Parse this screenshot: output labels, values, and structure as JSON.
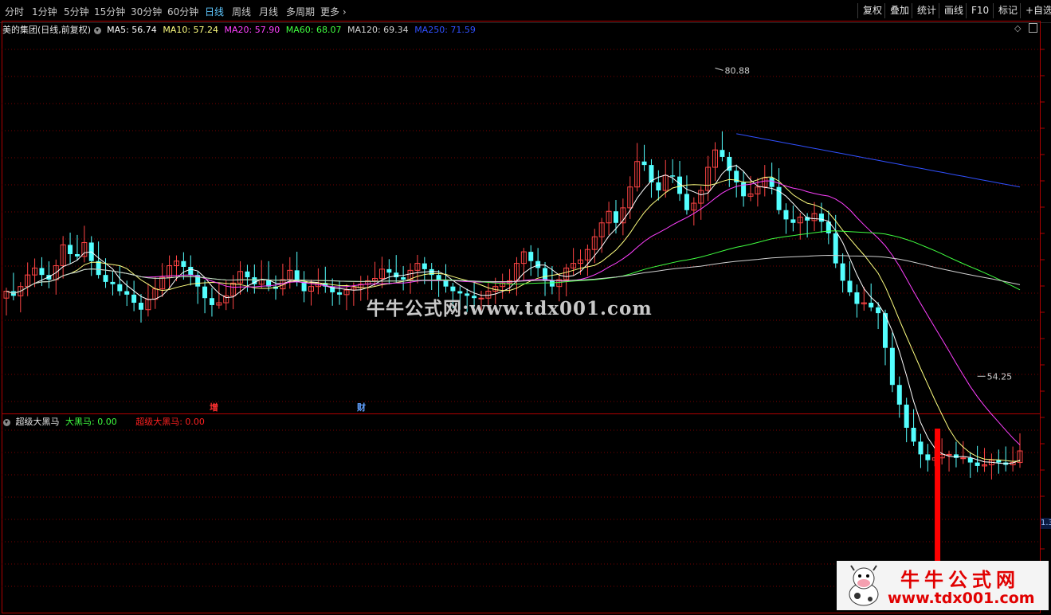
{
  "toolbar": {
    "timeframes": [
      "分时",
      "1分钟",
      "5分钟",
      "15分钟",
      "30分钟",
      "60分钟",
      "日线",
      "周线",
      "月线",
      "多周期",
      "更多"
    ],
    "active_timeframe": "日线",
    "right_buttons": [
      "复权",
      "叠加",
      "统计",
      "画线",
      "F10",
      "标记",
      "+自选"
    ]
  },
  "stock": {
    "title": "美的集团(日线,前复权)"
  },
  "ma_legend": [
    {
      "label": "MA5: 56.74",
      "color": "#ffffff"
    },
    {
      "label": "MA10: 57.24",
      "color": "#ffff80"
    },
    {
      "label": "MA20: 57.90",
      "color": "#ff40ff"
    },
    {
      "label": "MA60: 68.07",
      "color": "#40ff40"
    },
    {
      "label": "MA120: 69.34",
      "color": "#d0d0d0"
    },
    {
      "label": "MA250: 71.59",
      "color": "#3050ff"
    }
  ],
  "indicator": {
    "name": "超级大黑马",
    "series": [
      {
        "label": "大黑马: 0.00",
        "color": "#40ff40"
      },
      {
        "label": "超级大黑马: 0.00",
        "color": "#ff2020"
      }
    ],
    "right_label": "1.3"
  },
  "markers": [
    {
      "text": "增",
      "color": "#ff3030"
    },
    {
      "text": "财",
      "color": "#60a0ff"
    }
  ],
  "watermark": "牛牛公式网:www.tdx001.com",
  "logo": {
    "title": "牛牛公式网",
    "url": "www.tdx001.com"
  },
  "chart_data": {
    "type": "candlestick",
    "title": "美的集团(日线,前复权)",
    "high_label": "80.88",
    "low_label": "54.25",
    "ylim": [
      52,
      84
    ],
    "closes": [
      61.6,
      61.2,
      62.0,
      63.0,
      63.6,
      63.0,
      62.6,
      63.8,
      65.6,
      64.8,
      64.6,
      65.8,
      64.2,
      63.0,
      62.4,
      62.2,
      61.6,
      61.3,
      60.6,
      60.0,
      60.9,
      61.8,
      62.8,
      63.8,
      64.2,
      63.7,
      63.0,
      62.0,
      61.0,
      60.4,
      60.6,
      61.2,
      62.3,
      63.3,
      62.8,
      62.2,
      62.6,
      62.0,
      61.8,
      62.6,
      63.4,
      62.4,
      61.6,
      62.0,
      62.3,
      62.0,
      61.5,
      61.3,
      61.7,
      61.9,
      62.2,
      62.5,
      62.7,
      63.5,
      63.2,
      62.8,
      62.6,
      63.4,
      64.0,
      63.5,
      63.0,
      62.5,
      62.0,
      61.6,
      61.4,
      61.2,
      61.0,
      61.0,
      61.6,
      62.0,
      62.3,
      62.5,
      64.0,
      65.0,
      64.2,
      63.6,
      62.5,
      62.0,
      62.6,
      63.6,
      64.0,
      64.3,
      65.2,
      66.3,
      67.5,
      68.5,
      67.5,
      68.8,
      70.6,
      72.8,
      72.5,
      71.0,
      70.3,
      71.6,
      71.5,
      70.0,
      68.6,
      69.2,
      70.3,
      72.3,
      73.8,
      73.2,
      72.0,
      71.0,
      69.8,
      70.0,
      70.6,
      71.4,
      70.6,
      68.6,
      67.8,
      67.5,
      68.0,
      67.7,
      68.3,
      67.6,
      66.6,
      64.0,
      62.5,
      61.5,
      60.5,
      60.6,
      60.2,
      59.7,
      56.7,
      53.5,
      51.8,
      49.8,
      48.6,
      47.5,
      47.0,
      47.2,
      47.5,
      47.5,
      47.2,
      47.2,
      46.8,
      46.5,
      46.6,
      47.0,
      46.8,
      46.6,
      46.8,
      47.8
    ],
    "volume_bar_position": 0.905,
    "indicator_values": {
      "大黑马": 0.0,
      "超级大黑马": 0.0
    }
  }
}
